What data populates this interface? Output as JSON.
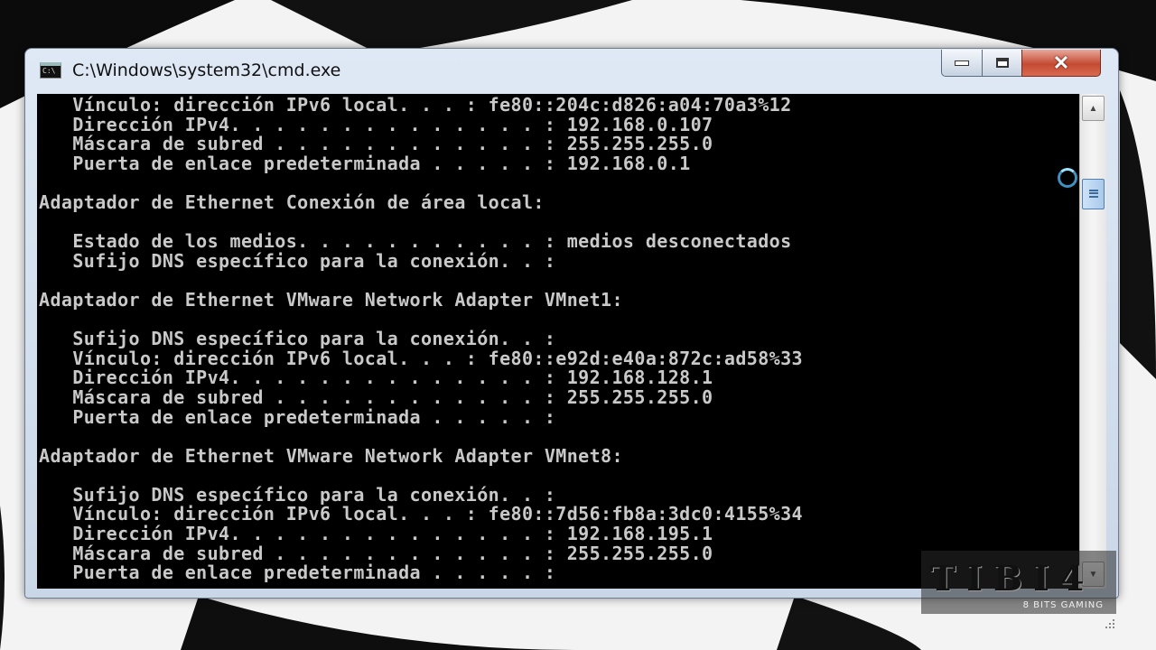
{
  "window": {
    "title": "C:\\Windows\\system32\\cmd.exe",
    "app_icon_label": "C:\\"
  },
  "console": {
    "lines": [
      "   Vínculo: dirección IPv6 local. . . : fe80::204c:d826:a04:70a3%12",
      "   Dirección IPv4. . . . . . . . . . . . . . : 192.168.0.107",
      "   Máscara de subred . . . . . . . . . . . . : 255.255.255.0",
      "   Puerta de enlace predeterminada . . . . . : 192.168.0.1",
      "",
      "Adaptador de Ethernet Conexión de área local:",
      "",
      "   Estado de los medios. . . . . . . . . . . : medios desconectados",
      "   Sufijo DNS específico para la conexión. . :",
      "",
      "Adaptador de Ethernet VMware Network Adapter VMnet1:",
      "",
      "   Sufijo DNS específico para la conexión. . :",
      "   Vínculo: dirección IPv6 local. . . : fe80::e92d:e40a:872c:ad58%33",
      "   Dirección IPv4. . . . . . . . . . . . . . : 192.168.128.1",
      "   Máscara de subred . . . . . . . . . . . . : 255.255.255.0",
      "   Puerta de enlace predeterminada . . . . . :",
      "",
      "Adaptador de Ethernet VMware Network Adapter VMnet8:",
      "",
      "   Sufijo DNS específico para la conexión. . :",
      "   Vínculo: dirección IPv6 local. . . : fe80::7d56:fb8a:3dc0:4155%34",
      "   Dirección IPv4. . . . . . . . . . . . . . : 192.168.195.1",
      "   Máscara de subred . . . . . . . . . . . . : 255.255.255.0",
      "   Puerta de enlace predeterminada . . . . . :"
    ]
  },
  "scrollbar": {
    "position_fraction": 0.14
  },
  "watermark": {
    "title": "TIBI4",
    "subtitle": "8 BITS GAMING"
  },
  "icons": [
    "cmd-app-icon",
    "minimize-icon",
    "maximize-icon",
    "close-icon",
    "scroll-up-arrow-icon",
    "scroll-down-arrow-icon",
    "busy-cursor-icon",
    "resize-grip-icon"
  ]
}
